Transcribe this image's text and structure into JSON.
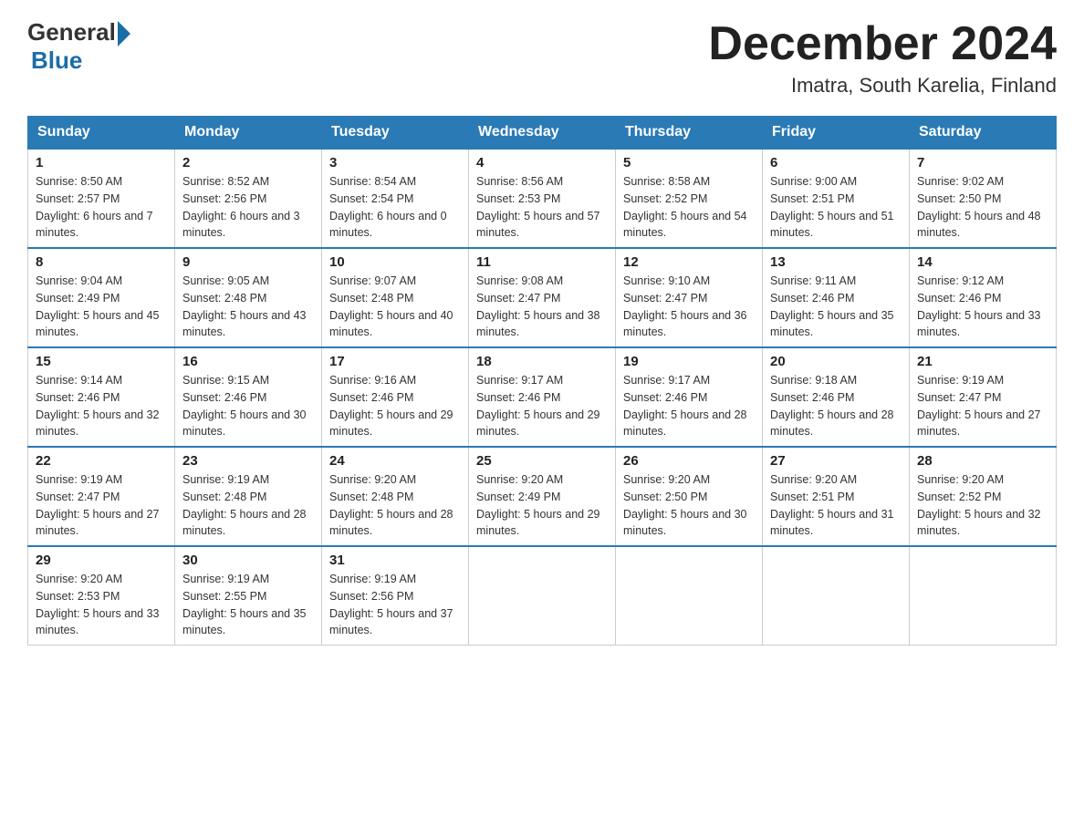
{
  "header": {
    "logo_general": "General",
    "logo_blue": "Blue",
    "title": "December 2024",
    "subtitle": "Imatra, South Karelia, Finland"
  },
  "weekdays": [
    "Sunday",
    "Monday",
    "Tuesday",
    "Wednesday",
    "Thursday",
    "Friday",
    "Saturday"
  ],
  "weeks": [
    [
      {
        "day": "1",
        "sunrise": "8:50 AM",
        "sunset": "2:57 PM",
        "daylight": "6 hours and 7 minutes."
      },
      {
        "day": "2",
        "sunrise": "8:52 AM",
        "sunset": "2:56 PM",
        "daylight": "6 hours and 3 minutes."
      },
      {
        "day": "3",
        "sunrise": "8:54 AM",
        "sunset": "2:54 PM",
        "daylight": "6 hours and 0 minutes."
      },
      {
        "day": "4",
        "sunrise": "8:56 AM",
        "sunset": "2:53 PM",
        "daylight": "5 hours and 57 minutes."
      },
      {
        "day": "5",
        "sunrise": "8:58 AM",
        "sunset": "2:52 PM",
        "daylight": "5 hours and 54 minutes."
      },
      {
        "day": "6",
        "sunrise": "9:00 AM",
        "sunset": "2:51 PM",
        "daylight": "5 hours and 51 minutes."
      },
      {
        "day": "7",
        "sunrise": "9:02 AM",
        "sunset": "2:50 PM",
        "daylight": "5 hours and 48 minutes."
      }
    ],
    [
      {
        "day": "8",
        "sunrise": "9:04 AM",
        "sunset": "2:49 PM",
        "daylight": "5 hours and 45 minutes."
      },
      {
        "day": "9",
        "sunrise": "9:05 AM",
        "sunset": "2:48 PM",
        "daylight": "5 hours and 43 minutes."
      },
      {
        "day": "10",
        "sunrise": "9:07 AM",
        "sunset": "2:48 PM",
        "daylight": "5 hours and 40 minutes."
      },
      {
        "day": "11",
        "sunrise": "9:08 AM",
        "sunset": "2:47 PM",
        "daylight": "5 hours and 38 minutes."
      },
      {
        "day": "12",
        "sunrise": "9:10 AM",
        "sunset": "2:47 PM",
        "daylight": "5 hours and 36 minutes."
      },
      {
        "day": "13",
        "sunrise": "9:11 AM",
        "sunset": "2:46 PM",
        "daylight": "5 hours and 35 minutes."
      },
      {
        "day": "14",
        "sunrise": "9:12 AM",
        "sunset": "2:46 PM",
        "daylight": "5 hours and 33 minutes."
      }
    ],
    [
      {
        "day": "15",
        "sunrise": "9:14 AM",
        "sunset": "2:46 PM",
        "daylight": "5 hours and 32 minutes."
      },
      {
        "day": "16",
        "sunrise": "9:15 AM",
        "sunset": "2:46 PM",
        "daylight": "5 hours and 30 minutes."
      },
      {
        "day": "17",
        "sunrise": "9:16 AM",
        "sunset": "2:46 PM",
        "daylight": "5 hours and 29 minutes."
      },
      {
        "day": "18",
        "sunrise": "9:17 AM",
        "sunset": "2:46 PM",
        "daylight": "5 hours and 29 minutes."
      },
      {
        "day": "19",
        "sunrise": "9:17 AM",
        "sunset": "2:46 PM",
        "daylight": "5 hours and 28 minutes."
      },
      {
        "day": "20",
        "sunrise": "9:18 AM",
        "sunset": "2:46 PM",
        "daylight": "5 hours and 28 minutes."
      },
      {
        "day": "21",
        "sunrise": "9:19 AM",
        "sunset": "2:47 PM",
        "daylight": "5 hours and 27 minutes."
      }
    ],
    [
      {
        "day": "22",
        "sunrise": "9:19 AM",
        "sunset": "2:47 PM",
        "daylight": "5 hours and 27 minutes."
      },
      {
        "day": "23",
        "sunrise": "9:19 AM",
        "sunset": "2:48 PM",
        "daylight": "5 hours and 28 minutes."
      },
      {
        "day": "24",
        "sunrise": "9:20 AM",
        "sunset": "2:48 PM",
        "daylight": "5 hours and 28 minutes."
      },
      {
        "day": "25",
        "sunrise": "9:20 AM",
        "sunset": "2:49 PM",
        "daylight": "5 hours and 29 minutes."
      },
      {
        "day": "26",
        "sunrise": "9:20 AM",
        "sunset": "2:50 PM",
        "daylight": "5 hours and 30 minutes."
      },
      {
        "day": "27",
        "sunrise": "9:20 AM",
        "sunset": "2:51 PM",
        "daylight": "5 hours and 31 minutes."
      },
      {
        "day": "28",
        "sunrise": "9:20 AM",
        "sunset": "2:52 PM",
        "daylight": "5 hours and 32 minutes."
      }
    ],
    [
      {
        "day": "29",
        "sunrise": "9:20 AM",
        "sunset": "2:53 PM",
        "daylight": "5 hours and 33 minutes."
      },
      {
        "day": "30",
        "sunrise": "9:19 AM",
        "sunset": "2:55 PM",
        "daylight": "5 hours and 35 minutes."
      },
      {
        "day": "31",
        "sunrise": "9:19 AM",
        "sunset": "2:56 PM",
        "daylight": "5 hours and 37 minutes."
      },
      null,
      null,
      null,
      null
    ]
  ]
}
